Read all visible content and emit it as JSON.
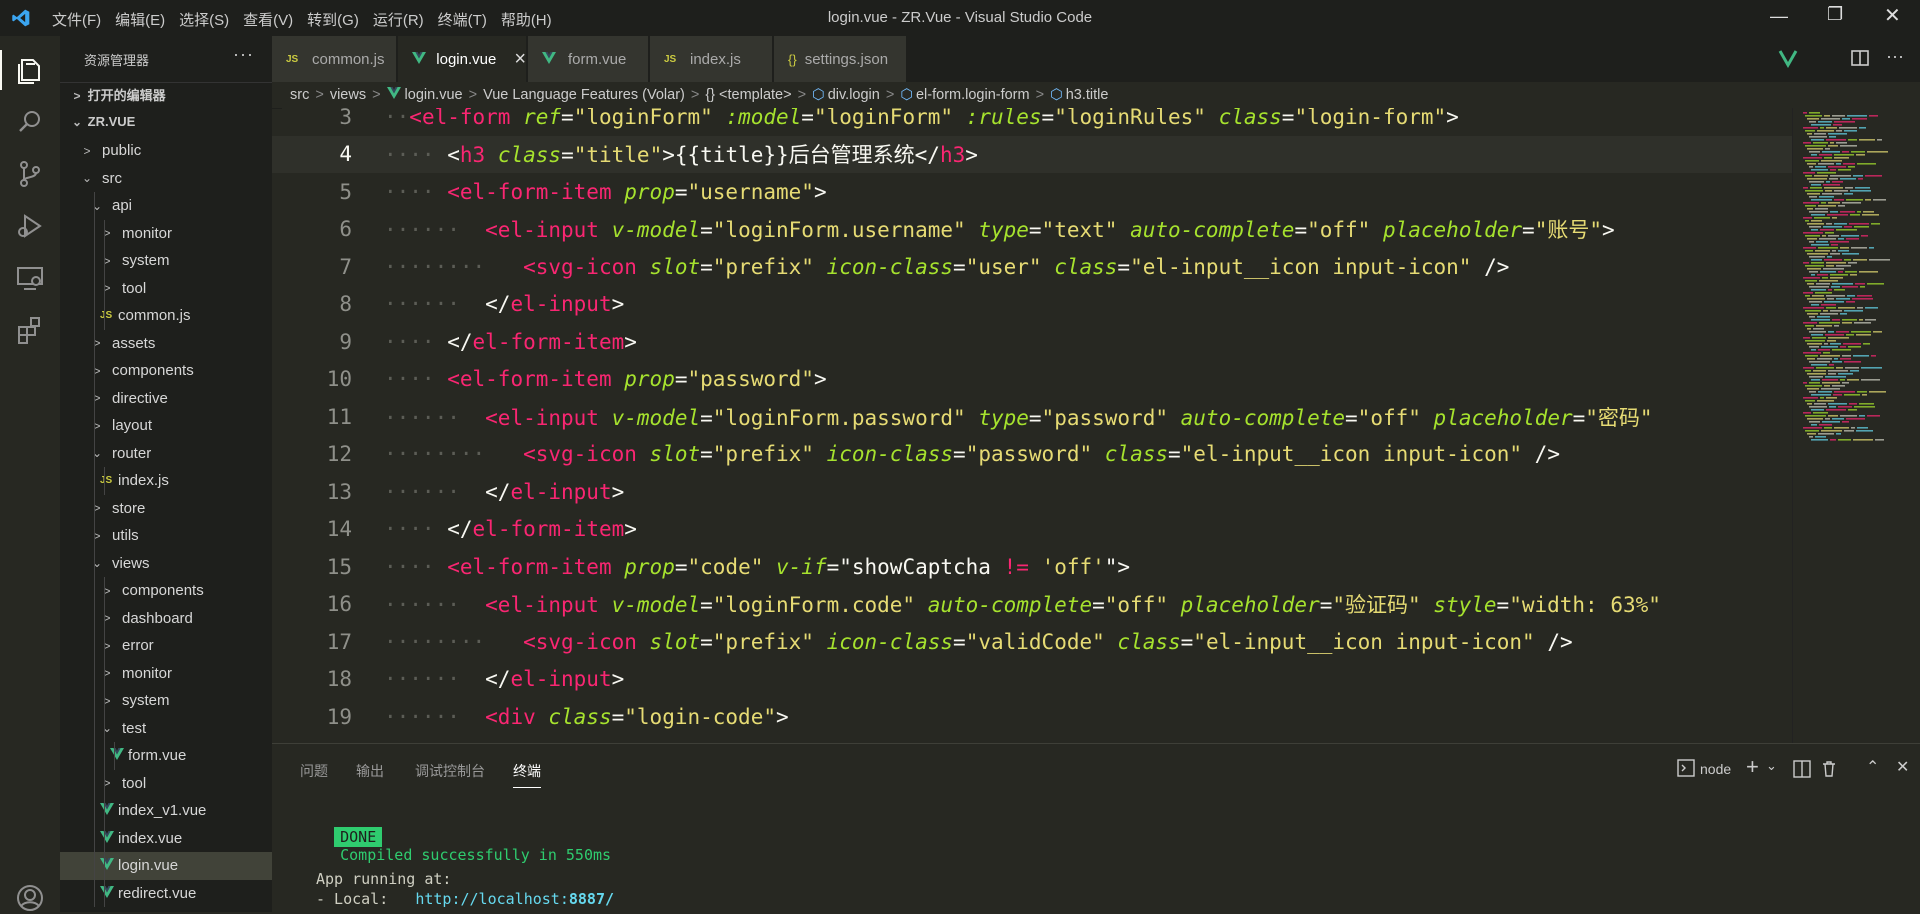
{
  "window": {
    "title": "login.vue - ZR.Vue - Visual Studio Code",
    "menu": [
      "文件(F)",
      "编辑(E)",
      "选择(S)",
      "查看(V)",
      "转到(G)",
      "运行(R)",
      "终端(T)",
      "帮助(H)"
    ]
  },
  "sidebar": {
    "header": "资源管理器",
    "open_editors": "打开的编辑器",
    "project": "ZR.VUE",
    "tree": [
      {
        "label": "public",
        "depth": 1,
        "type": "folder",
        "expanded": false
      },
      {
        "label": "src",
        "depth": 1,
        "type": "folder",
        "expanded": true
      },
      {
        "label": "api",
        "depth": 2,
        "type": "folder",
        "expanded": true
      },
      {
        "label": "monitor",
        "depth": 3,
        "type": "folder",
        "expanded": false
      },
      {
        "label": "system",
        "depth": 3,
        "type": "folder",
        "expanded": false
      },
      {
        "label": "tool",
        "depth": 3,
        "type": "folder",
        "expanded": false
      },
      {
        "label": "common.js",
        "depth": 3,
        "type": "js"
      },
      {
        "label": "assets",
        "depth": 2,
        "type": "folder",
        "expanded": false
      },
      {
        "label": "components",
        "depth": 2,
        "type": "folder",
        "expanded": false
      },
      {
        "label": "directive",
        "depth": 2,
        "type": "folder",
        "expanded": false
      },
      {
        "label": "layout",
        "depth": 2,
        "type": "folder",
        "expanded": false
      },
      {
        "label": "router",
        "depth": 2,
        "type": "folder",
        "expanded": true
      },
      {
        "label": "index.js",
        "depth": 3,
        "type": "js"
      },
      {
        "label": "store",
        "depth": 2,
        "type": "folder",
        "expanded": false
      },
      {
        "label": "utils",
        "depth": 2,
        "type": "folder",
        "expanded": false
      },
      {
        "label": "views",
        "depth": 2,
        "type": "folder",
        "expanded": true
      },
      {
        "label": "components",
        "depth": 3,
        "type": "folder",
        "expanded": false
      },
      {
        "label": "dashboard",
        "depth": 3,
        "type": "folder",
        "expanded": false
      },
      {
        "label": "error",
        "depth": 3,
        "type": "folder",
        "expanded": false
      },
      {
        "label": "monitor",
        "depth": 3,
        "type": "folder",
        "expanded": false
      },
      {
        "label": "system",
        "depth": 3,
        "type": "folder",
        "expanded": false
      },
      {
        "label": "test",
        "depth": 3,
        "type": "folder",
        "expanded": true
      },
      {
        "label": "form.vue",
        "depth": 4,
        "type": "vue"
      },
      {
        "label": "tool",
        "depth": 3,
        "type": "folder",
        "expanded": false
      },
      {
        "label": "index_v1.vue",
        "depth": 3,
        "type": "vue"
      },
      {
        "label": "index.vue",
        "depth": 3,
        "type": "vue"
      },
      {
        "label": "login.vue",
        "depth": 3,
        "type": "vue",
        "active": true
      },
      {
        "label": "redirect.vue",
        "depth": 3,
        "type": "vue"
      }
    ]
  },
  "tabs": [
    {
      "label": "common.js",
      "type": "js"
    },
    {
      "label": "login.vue",
      "type": "vue",
      "active": true,
      "close": "×"
    },
    {
      "label": "form.vue",
      "type": "vue"
    },
    {
      "label": "index.js",
      "type": "js"
    },
    {
      "label": "settings.json",
      "type": "json"
    }
  ],
  "breadcrumb": [
    "src",
    "views",
    "login.vue",
    "Vue Language Features (Volar)",
    "<template>",
    "div.login",
    "el-form.login-form",
    "h3.title"
  ],
  "editor": {
    "cursor_line": 4,
    "lines": [
      {
        "n": "3",
        "indent": 1,
        "tokens": [
          [
            "tg",
            "<el-form"
          ],
          [
            "pu",
            " "
          ],
          [
            "at",
            "ref"
          ],
          [
            "pu",
            "="
          ],
          [
            "st",
            "\"loginForm\""
          ],
          [
            "pu",
            " "
          ],
          [
            "at",
            ":model"
          ],
          [
            "pu",
            "="
          ],
          [
            "st",
            "\"loginForm\""
          ],
          [
            "pu",
            " "
          ],
          [
            "at",
            ":rules"
          ],
          [
            "pu",
            "="
          ],
          [
            "st",
            "\"loginRules\""
          ],
          [
            "pu",
            " "
          ],
          [
            "at",
            "class"
          ],
          [
            "pu",
            "="
          ],
          [
            "st",
            "\"login-form\""
          ],
          [
            "pu",
            ">"
          ]
        ]
      },
      {
        "n": "4",
        "indent": 2,
        "tokens": [
          [
            "pu",
            "<"
          ],
          [
            "tg",
            "h3"
          ],
          [
            "pu",
            " "
          ],
          [
            "at",
            "class"
          ],
          [
            "pu",
            "="
          ],
          [
            "st",
            "\"title\""
          ],
          [
            "pu",
            ">{{title}}后台管理系统</"
          ],
          [
            "tg",
            "h3"
          ],
          [
            "pu",
            ">"
          ]
        ]
      },
      {
        "n": "5",
        "indent": 2,
        "tokens": [
          [
            "tg",
            "<el-form-item"
          ],
          [
            "pu",
            " "
          ],
          [
            "at",
            "prop"
          ],
          [
            "pu",
            "="
          ],
          [
            "st",
            "\"username\""
          ],
          [
            "pu",
            ">"
          ]
        ]
      },
      {
        "n": "6",
        "indent": 3,
        "tokens": [
          [
            "tg",
            "<el-input"
          ],
          [
            "pu",
            " "
          ],
          [
            "at",
            "v-model"
          ],
          [
            "pu",
            "="
          ],
          [
            "st",
            "\"loginForm.username\""
          ],
          [
            "pu",
            " "
          ],
          [
            "at",
            "type"
          ],
          [
            "pu",
            "="
          ],
          [
            "st",
            "\"text\""
          ],
          [
            "pu",
            " "
          ],
          [
            "at",
            "auto-complete"
          ],
          [
            "pu",
            "="
          ],
          [
            "st",
            "\"off\""
          ],
          [
            "pu",
            " "
          ],
          [
            "at",
            "placeholder"
          ],
          [
            "pu",
            "="
          ],
          [
            "st",
            "\"账号\""
          ],
          [
            "pu",
            ">"
          ]
        ]
      },
      {
        "n": "7",
        "indent": 4,
        "tokens": [
          [
            "tg",
            "<svg-icon"
          ],
          [
            "pu",
            " "
          ],
          [
            "at",
            "slot"
          ],
          [
            "pu",
            "="
          ],
          [
            "st",
            "\"prefix\""
          ],
          [
            "pu",
            " "
          ],
          [
            "at",
            "icon-class"
          ],
          [
            "pu",
            "="
          ],
          [
            "st",
            "\"user\""
          ],
          [
            "pu",
            " "
          ],
          [
            "at",
            "class"
          ],
          [
            "pu",
            "="
          ],
          [
            "st",
            "\"el-input__icon input-icon\""
          ],
          [
            "pu",
            " />"
          ]
        ]
      },
      {
        "n": "8",
        "indent": 3,
        "tokens": [
          [
            "pu",
            "</"
          ],
          [
            "tg",
            "el-input"
          ],
          [
            "pu",
            ">"
          ]
        ]
      },
      {
        "n": "9",
        "indent": 2,
        "tokens": [
          [
            "pu",
            "</"
          ],
          [
            "tg",
            "el-form-item"
          ],
          [
            "pu",
            ">"
          ]
        ]
      },
      {
        "n": "10",
        "indent": 2,
        "tokens": [
          [
            "tg",
            "<el-form-item"
          ],
          [
            "pu",
            " "
          ],
          [
            "at",
            "prop"
          ],
          [
            "pu",
            "="
          ],
          [
            "st",
            "\"password\""
          ],
          [
            "pu",
            ">"
          ]
        ]
      },
      {
        "n": "11",
        "indent": 3,
        "tokens": [
          [
            "tg",
            "<el-input"
          ],
          [
            "pu",
            " "
          ],
          [
            "at",
            "v-model"
          ],
          [
            "pu",
            "="
          ],
          [
            "st",
            "\"loginForm.password\""
          ],
          [
            "pu",
            " "
          ],
          [
            "at",
            "type"
          ],
          [
            "pu",
            "="
          ],
          [
            "st",
            "\"password\""
          ],
          [
            "pu",
            " "
          ],
          [
            "at",
            "auto-complete"
          ],
          [
            "pu",
            "="
          ],
          [
            "st",
            "\"off\""
          ],
          [
            "pu",
            " "
          ],
          [
            "at",
            "placeholder"
          ],
          [
            "pu",
            "="
          ],
          [
            "st",
            "\"密码\""
          ]
        ]
      },
      {
        "n": "12",
        "indent": 4,
        "tokens": [
          [
            "tg",
            "<svg-icon"
          ],
          [
            "pu",
            " "
          ],
          [
            "at",
            "slot"
          ],
          [
            "pu",
            "="
          ],
          [
            "st",
            "\"prefix\""
          ],
          [
            "pu",
            " "
          ],
          [
            "at",
            "icon-class"
          ],
          [
            "pu",
            "="
          ],
          [
            "st",
            "\"password\""
          ],
          [
            "pu",
            " "
          ],
          [
            "at",
            "class"
          ],
          [
            "pu",
            "="
          ],
          [
            "st",
            "\"el-input__icon input-icon\""
          ],
          [
            "pu",
            " />"
          ]
        ]
      },
      {
        "n": "13",
        "indent": 3,
        "tokens": [
          [
            "pu",
            "</"
          ],
          [
            "tg",
            "el-input"
          ],
          [
            "pu",
            ">"
          ]
        ]
      },
      {
        "n": "14",
        "indent": 2,
        "tokens": [
          [
            "pu",
            "</"
          ],
          [
            "tg",
            "el-form-item"
          ],
          [
            "pu",
            ">"
          ]
        ]
      },
      {
        "n": "15",
        "indent": 2,
        "tokens": [
          [
            "tg",
            "<el-form-item"
          ],
          [
            "pu",
            " "
          ],
          [
            "at",
            "prop"
          ],
          [
            "pu",
            "="
          ],
          [
            "st",
            "\"code\""
          ],
          [
            "pu",
            " "
          ],
          [
            "at",
            "v-if"
          ],
          [
            "pu",
            "=\"showCaptcha "
          ],
          [
            "tg",
            "!="
          ],
          [
            "pu",
            " "
          ],
          [
            "st",
            "'off'"
          ],
          [
            "pu",
            "\">"
          ]
        ]
      },
      {
        "n": "16",
        "indent": 3,
        "tokens": [
          [
            "tg",
            "<el-input"
          ],
          [
            "pu",
            " "
          ],
          [
            "at",
            "v-model"
          ],
          [
            "pu",
            "="
          ],
          [
            "st",
            "\"loginForm.code\""
          ],
          [
            "pu",
            " "
          ],
          [
            "at",
            "auto-complete"
          ],
          [
            "pu",
            "="
          ],
          [
            "st",
            "\"off\""
          ],
          [
            "pu",
            " "
          ],
          [
            "at",
            "placeholder"
          ],
          [
            "pu",
            "="
          ],
          [
            "st",
            "\"验证码\""
          ],
          [
            "pu",
            " "
          ],
          [
            "at",
            "style"
          ],
          [
            "pu",
            "="
          ],
          [
            "st",
            "\"width: 63%\""
          ]
        ]
      },
      {
        "n": "17",
        "indent": 4,
        "tokens": [
          [
            "tg",
            "<svg-icon"
          ],
          [
            "pu",
            " "
          ],
          [
            "at",
            "slot"
          ],
          [
            "pu",
            "="
          ],
          [
            "st",
            "\"prefix\""
          ],
          [
            "pu",
            " "
          ],
          [
            "at",
            "icon-class"
          ],
          [
            "pu",
            "="
          ],
          [
            "st",
            "\"validCode\""
          ],
          [
            "pu",
            " "
          ],
          [
            "at",
            "class"
          ],
          [
            "pu",
            "="
          ],
          [
            "st",
            "\"el-input__icon input-icon\""
          ],
          [
            "pu",
            " />"
          ]
        ]
      },
      {
        "n": "18",
        "indent": 3,
        "tokens": [
          [
            "pu",
            "</"
          ],
          [
            "tg",
            "el-input"
          ],
          [
            "pu",
            ">"
          ]
        ]
      },
      {
        "n": "19",
        "indent": 3,
        "tokens": [
          [
            "tg",
            "<div"
          ],
          [
            "pu",
            " "
          ],
          [
            "at",
            "class"
          ],
          [
            "pu",
            "="
          ],
          [
            "st",
            "\"login-code\""
          ],
          [
            "pu",
            ">"
          ]
        ]
      }
    ]
  },
  "panel": {
    "tabs": [
      "问题",
      "输出",
      "调试控制台",
      "终端"
    ],
    "active_tab": "终端",
    "terminal_name": "node",
    "done_badge": "DONE",
    "done_text": "Compiled successfully in 550ms",
    "app_running": "App running at:",
    "local_label": "- Local:   ",
    "local_url_host": "http://localhost:",
    "local_url_port": "8887/"
  },
  "colors": {
    "tag": "#f92672",
    "attr": "#a6e22e",
    "string": "#e6db74",
    "background": "#272822",
    "done_badge": "#2fcc6f"
  }
}
